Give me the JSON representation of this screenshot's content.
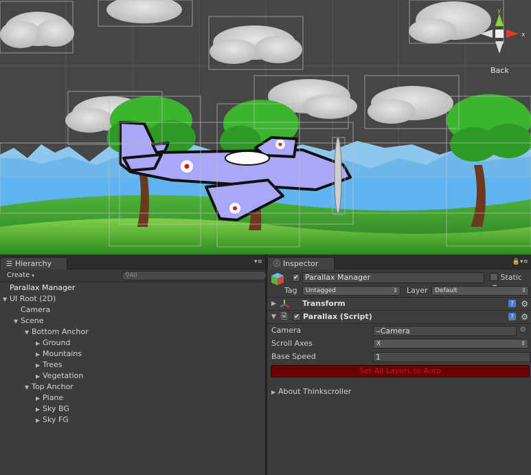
{
  "scene": {
    "gizmo_label": "Back",
    "gizmo_axis_y": "y",
    "gizmo_axis_x": "x"
  },
  "hierarchy": {
    "tab_label": "Hierarchy",
    "create_label": "Create",
    "search_placeholder": "All",
    "items": [
      {
        "label": "Parallax Manager",
        "depth": 0,
        "arrow": ""
      },
      {
        "label": "UI Root (2D)",
        "depth": 0,
        "arrow": "▼"
      },
      {
        "label": "Camera",
        "depth": 1,
        "arrow": ""
      },
      {
        "label": "Scene",
        "depth": 1,
        "arrow": "▼"
      },
      {
        "label": "Bottom Anchor",
        "depth": 2,
        "arrow": "▼"
      },
      {
        "label": "Ground",
        "depth": 3,
        "arrow": "▶"
      },
      {
        "label": "Mountains",
        "depth": 3,
        "arrow": "▶"
      },
      {
        "label": "Trees",
        "depth": 3,
        "arrow": "▶"
      },
      {
        "label": "Vegetation",
        "depth": 3,
        "arrow": "▶"
      },
      {
        "label": "Top Anchor",
        "depth": 2,
        "arrow": "▼"
      },
      {
        "label": "Plane",
        "depth": 3,
        "arrow": "▶"
      },
      {
        "label": "Sky BG",
        "depth": 3,
        "arrow": "▶"
      },
      {
        "label": "Sky FG",
        "depth": 3,
        "arrow": "▶"
      }
    ]
  },
  "inspector": {
    "tab_label": "Inspector",
    "object_name": "Parallax Manager",
    "static_label": "Static",
    "tag_label": "Tag",
    "tag_value": "Untagged",
    "layer_label": "Layer",
    "layer_value": "Default",
    "transform_label": "Transform",
    "script_label": "Parallax (Script)",
    "fields": {
      "camera_label": "Camera",
      "camera_value": "Camera",
      "scroll_label": "Scroll Axes",
      "scroll_value": "X",
      "speed_label": "Base Speed",
      "speed_value": "1"
    },
    "button_label": "Set All Layers to Auto",
    "about_label": "About Thinkscroller",
    "help_glyph": "?",
    "gear_glyph": "⚙"
  }
}
